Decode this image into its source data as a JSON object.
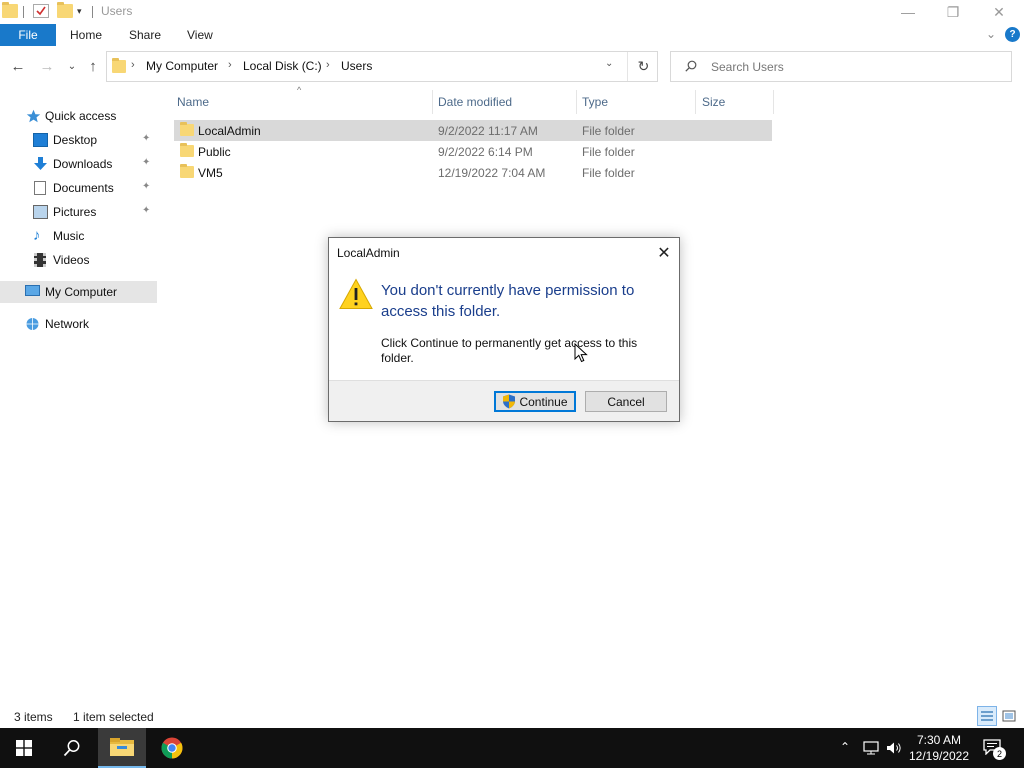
{
  "window": {
    "title": "Users",
    "controls": {
      "minimize": "—",
      "restore": "❐",
      "close": "✕"
    }
  },
  "ribbon": {
    "file_tab": "File",
    "tabs": [
      "Home",
      "Share",
      "View"
    ],
    "expand_glyph": "⌄",
    "help": "?"
  },
  "nav": {
    "back": "←",
    "forward": "→",
    "recent": "⌄",
    "up": "↑",
    "breadcrumb": [
      "My Computer",
      "Local Disk (C:)",
      "Users"
    ],
    "crumb_separator": "›",
    "dropdown": "⌄",
    "refresh": "↻",
    "search_placeholder": "Search Users"
  },
  "sidebar": {
    "items": [
      {
        "label": "Quick access",
        "icon": "star-icon"
      },
      {
        "label": "Desktop",
        "icon": "desktop-icon",
        "pinned": true
      },
      {
        "label": "Downloads",
        "icon": "download-icon",
        "pinned": true
      },
      {
        "label": "Documents",
        "icon": "document-icon",
        "pinned": true
      },
      {
        "label": "Pictures",
        "icon": "pictures-icon",
        "pinned": true
      },
      {
        "label": "Music",
        "icon": "music-icon"
      },
      {
        "label": "Videos",
        "icon": "video-icon"
      },
      {
        "label": "My Computer",
        "icon": "computer-icon",
        "selected": true
      },
      {
        "label": "Network",
        "icon": "network-icon"
      }
    ],
    "pin_glyph": "📌"
  },
  "filelist": {
    "columns": [
      "Name",
      "Date modified",
      "Type",
      "Size"
    ],
    "sort_glyph": "^",
    "rows": [
      {
        "name": "LocalAdmin",
        "date": "9/2/2022 11:17 AM",
        "type": "File folder",
        "size": "",
        "selected": true
      },
      {
        "name": "Public",
        "date": "9/2/2022 6:14 PM",
        "type": "File folder",
        "size": ""
      },
      {
        "name": "VM5",
        "date": "12/19/2022 7:04 AM",
        "type": "File folder",
        "size": ""
      }
    ]
  },
  "status": {
    "item_count": "3 items",
    "selection": "1 item selected"
  },
  "dialog": {
    "title": "LocalAdmin",
    "close_glyph": "✕",
    "main_text": "You don't currently have permission to access this folder.",
    "sub_text": "Click Continue to permanently get access to this folder.",
    "continue_label": "Continue",
    "cancel_label": "Cancel"
  },
  "taskbar": {
    "tray_up": "⌃",
    "time": "7:30 AM",
    "date": "12/19/2022",
    "notification_count": "2"
  },
  "colors": {
    "accent": "#1979ca",
    "folder": "#f8d775",
    "selection": "#d9d9d9",
    "dialog_heading": "#1a3e8c",
    "taskbar": "#101010"
  }
}
